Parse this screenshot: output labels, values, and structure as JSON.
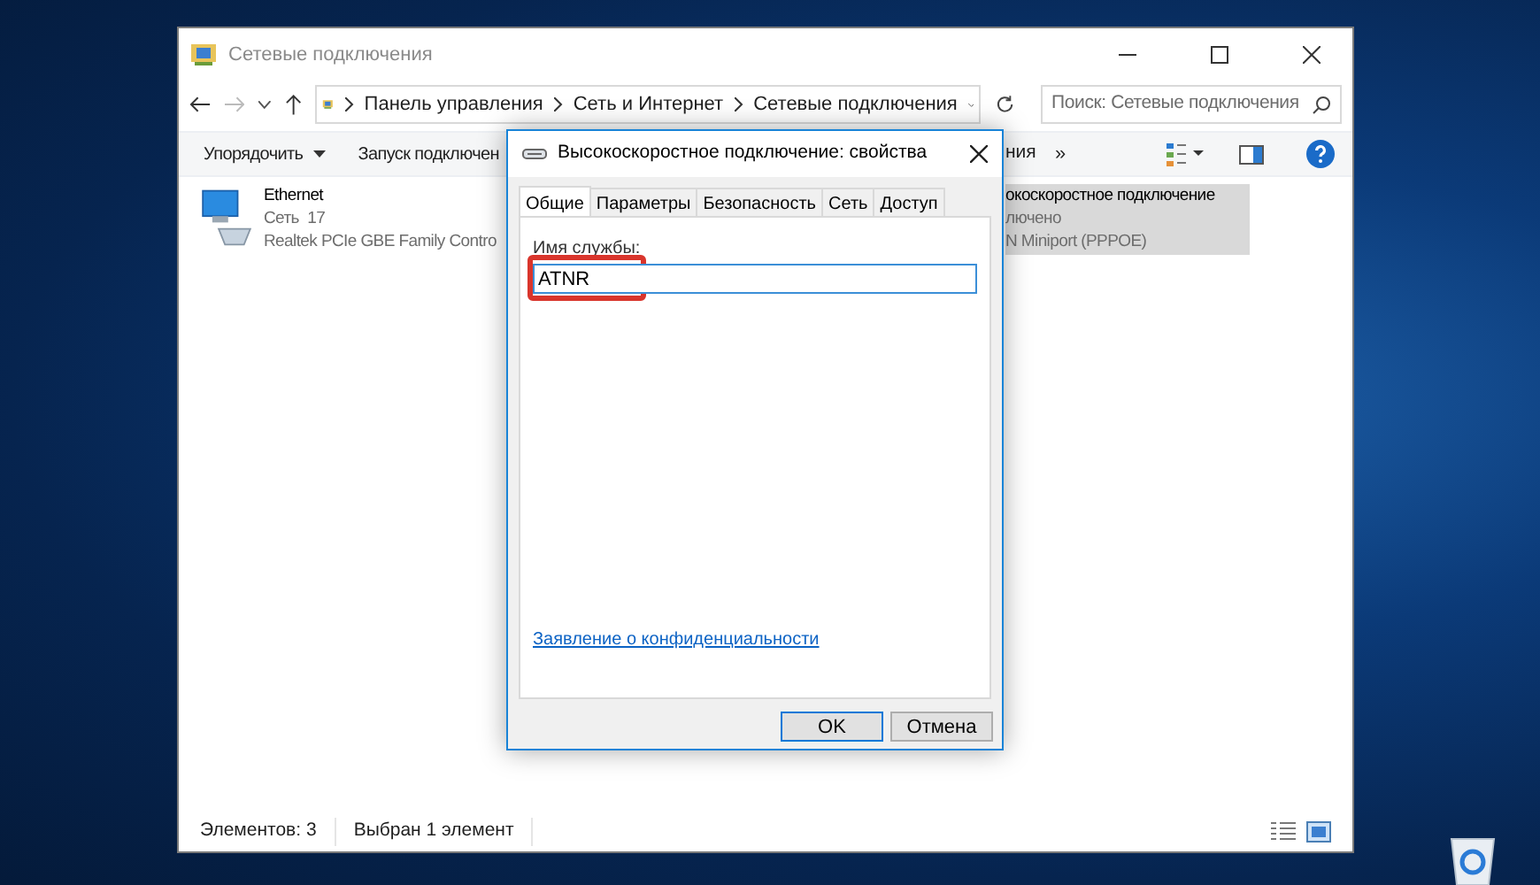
{
  "explorer": {
    "title": "Сетевые подключения",
    "breadcrumb": [
      "Панель управления",
      "Сеть и Интернет",
      "Сетевые подключения"
    ],
    "search": {
      "placeholder": "Поиск: Сетевые подключения"
    },
    "toolbar": [
      {
        "label": "Упорядочить",
        "dropdown": true
      },
      {
        "label": "Запуск подключен",
        "dropdown": false
      }
    ],
    "toolbar_fragment": "ния",
    "toolbar_overflow": "»",
    "connections": [
      {
        "name": "Ethernet",
        "line2": "Сеть  17",
        "line3": "Realtek PCIe GBE Family Contro",
        "selected": false
      },
      {
        "name": "окоскоростное подключение",
        "line2": "лючено",
        "line3": "N Miniport (PPPOE)",
        "selected": true
      }
    ],
    "status_bar": {
      "count": "Элементов: 3",
      "selection": "Выбран 1 элемент"
    }
  },
  "dialog": {
    "title": "Высокоскоростное подключение: свойства",
    "tabs": [
      {
        "label": "Общие",
        "selected": true
      },
      {
        "label": "Параметры",
        "selected": false
      },
      {
        "label": "Безопасность",
        "selected": false
      },
      {
        "label": "Сеть",
        "selected": false
      },
      {
        "label": "Доступ",
        "selected": false
      }
    ],
    "field": {
      "label": "Имя службы:",
      "value": "ATNR",
      "highlighted": true
    },
    "link": "Заявление о конфиденциальности",
    "buttons": [
      {
        "label": "OK",
        "default": true
      },
      {
        "label": "Отмена",
        "default": false
      }
    ]
  }
}
